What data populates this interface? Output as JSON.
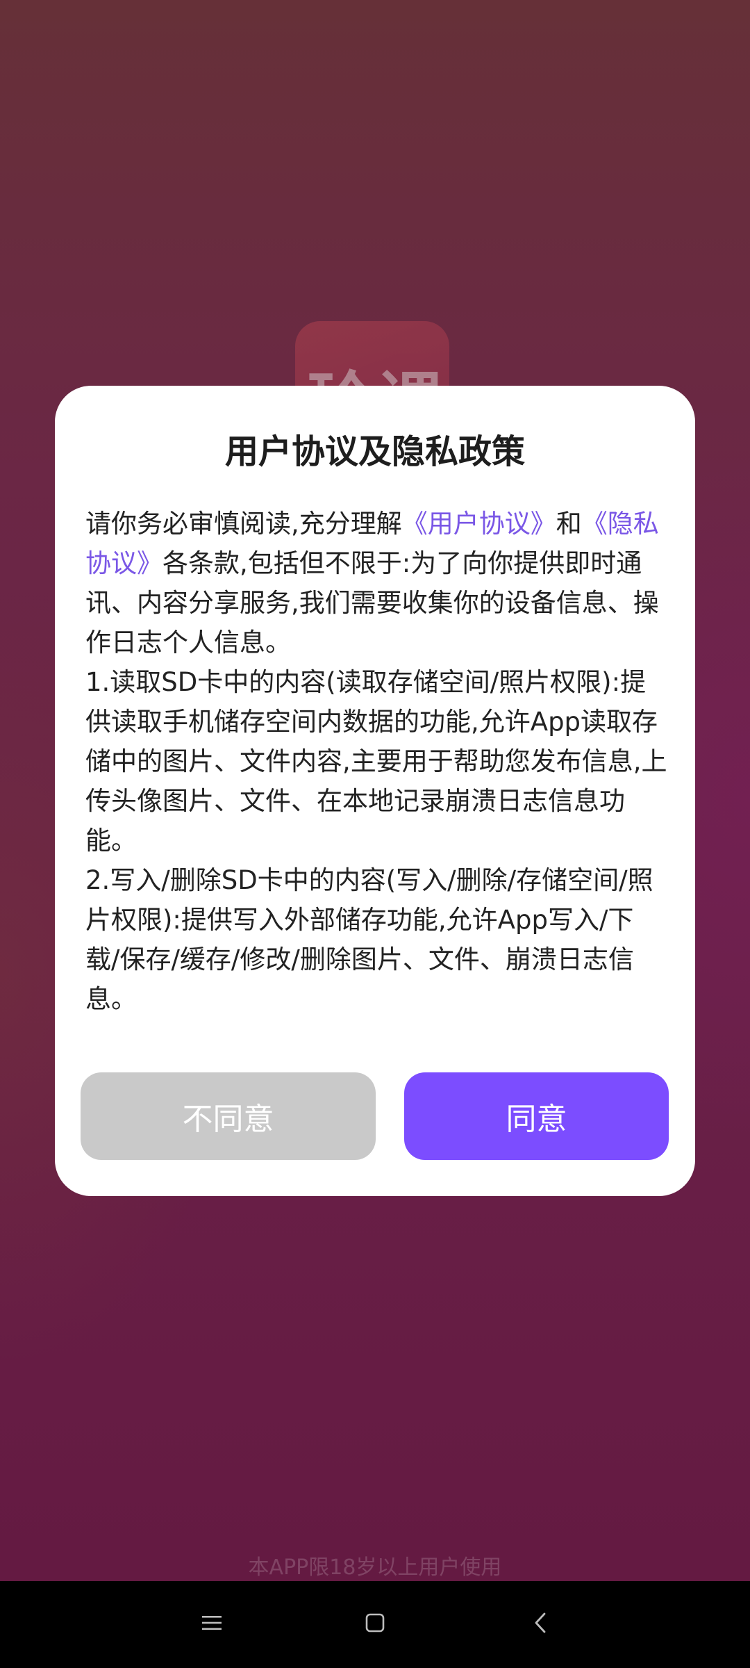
{
  "background": {
    "logo_text": "玲课",
    "age_notice": "本APP限18岁以上用户使用"
  },
  "dialog": {
    "title": "用户协议及隐私政策",
    "intro_prefix": "请你务必审慎阅读,充分理解",
    "user_agreement_link": "《用户协议》",
    "conjunction": "和",
    "privacy_link": "《隐私协议》",
    "intro_suffix": "各条款,包括但不限于:为了向你提供即时通讯、内容分享服务,我们需要收集你的设备信息、操作日志个人信息。",
    "item_1": "1.读取SD卡中的内容(读取存储空间/照片权限):提供读取手机储存空间内数据的功能,允许App读取存储中的图片、文件内容,主要用于帮助您发布信息,上传头像图片、文件、在本地记录崩溃日志信息功能。",
    "item_2": "2.写入/删除SD卡中的内容(写入/删除/存储空间/照片权限):提供写入外部储存功能,允许App写入/下载/保存/缓存/修改/删除图片、文件、崩溃日志信息。",
    "disagree_label": "不同意",
    "agree_label": "同意"
  },
  "navbar": {
    "menu_icon": "menu-icon",
    "home_icon": "home-square-icon",
    "back_icon": "back-chevron-icon"
  },
  "colors": {
    "accent": "#7c4dff",
    "link": "#7a57e6",
    "disabled_button": "#c9c9c9",
    "background": "#6a2148"
  }
}
